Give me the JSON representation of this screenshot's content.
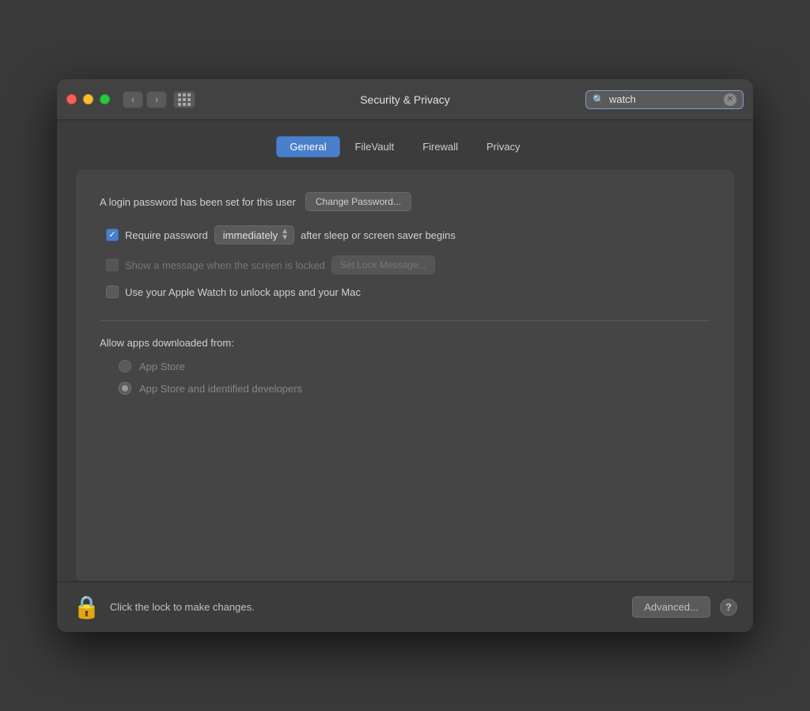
{
  "titlebar": {
    "title": "Security & Privacy",
    "search_placeholder": "watch",
    "search_value": "watch"
  },
  "tabs": [
    {
      "id": "general",
      "label": "General",
      "active": true
    },
    {
      "id": "filevault",
      "label": "FileVault",
      "active": false
    },
    {
      "id": "firewall",
      "label": "Firewall",
      "active": false
    },
    {
      "id": "privacy",
      "label": "Privacy",
      "active": false
    }
  ],
  "general": {
    "password_label": "A login password has been set for this user",
    "change_password_btn": "Change Password...",
    "require_password_label": "Require password",
    "require_password_dropdown": "immediately",
    "require_password_suffix": "after sleep or screen saver begins",
    "lock_message_label": "Show a message when the screen is locked",
    "set_lock_message_btn": "Set Lock Message...",
    "apple_watch_label": "Use your Apple Watch to unlock apps and your Mac",
    "allow_apps_label": "Allow apps downloaded from:",
    "radio_options": [
      {
        "id": "app_store",
        "label": "App Store",
        "selected": false
      },
      {
        "id": "app_store_identified",
        "label": "App Store and identified developers",
        "selected": true
      }
    ]
  },
  "bottom": {
    "lock_text": "Click the lock to make changes.",
    "advanced_btn": "Advanced...",
    "help_label": "?"
  }
}
